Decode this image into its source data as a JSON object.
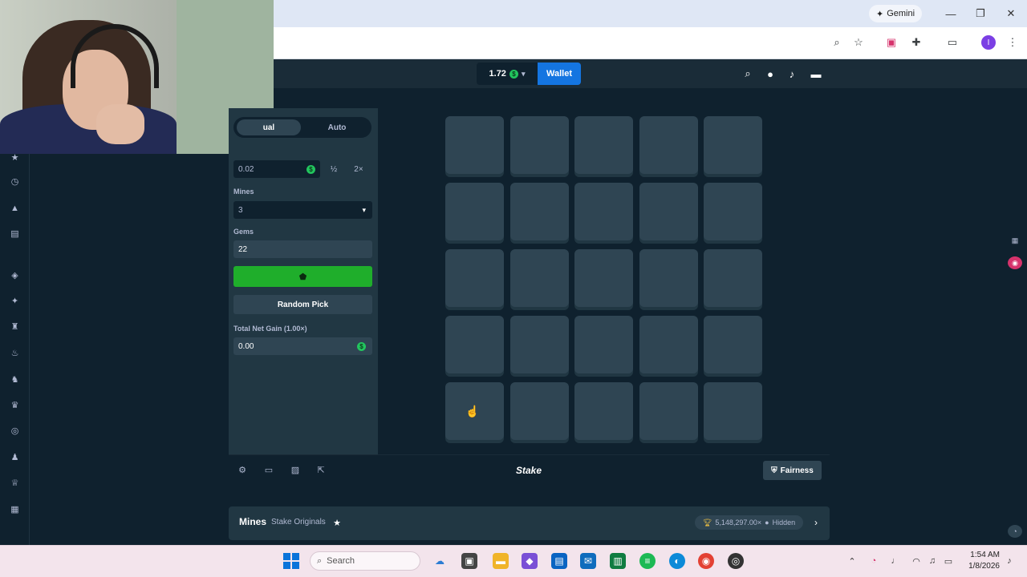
{
  "browser": {
    "gemini_label": "Gemini",
    "window_controls": [
      "minimize",
      "restore",
      "close"
    ],
    "profile_initial": "I"
  },
  "header": {
    "balance": "1.72",
    "currency_symbol": "$",
    "wallet_label": "Wallet"
  },
  "controls": {
    "tabs": [
      {
        "label": "ual",
        "active": true
      },
      {
        "label": "Auto",
        "active": false
      }
    ],
    "bet_amount": "0.02",
    "half_label": "½",
    "double_label": "2×",
    "mines_label": "Mines",
    "mines_value": "3",
    "gems_label": "Gems",
    "gems_value": "22",
    "random_pick_label": "Random Pick",
    "net_gain_label": "Total Net Gain (1.00×)",
    "net_gain_value": "0.00"
  },
  "board": {
    "rows": 5,
    "cols": 5,
    "tile_state": "hidden"
  },
  "footer": {
    "logo_text": "Stake",
    "fairness_label": "Fairness"
  },
  "game_info": {
    "title": "Mines",
    "provider": "Stake Originals",
    "wagered": "5,148,297.00×",
    "visibility": "Hidden"
  },
  "taskbar": {
    "search_label": "Search",
    "time": "1:54 AM",
    "date": "1/8/2026"
  },
  "colors": {
    "accent_green": "#1fae2b",
    "wallet_blue": "#1475e1",
    "panel": "#213743",
    "tile": "#2f4553",
    "background": "#0f212e"
  }
}
